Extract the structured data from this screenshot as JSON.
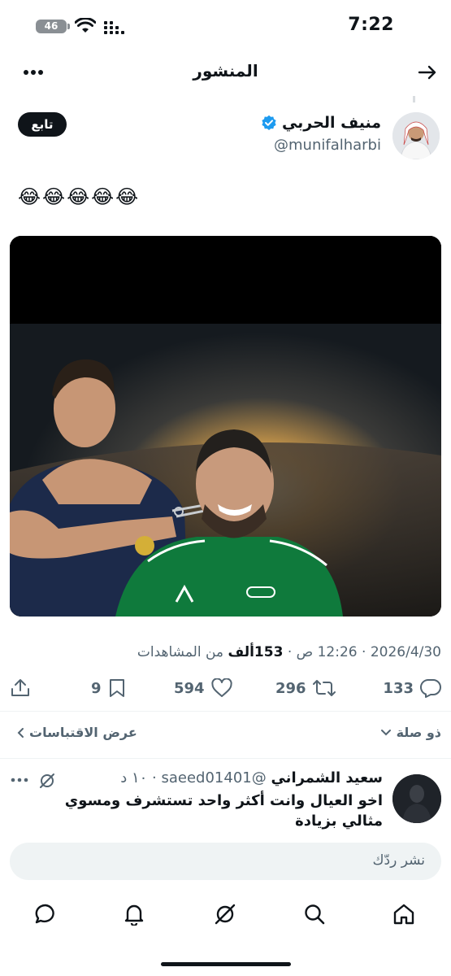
{
  "status_bar": {
    "time": "7:22",
    "battery": "46"
  },
  "header": {
    "title": "المنشور"
  },
  "author": {
    "name": "منيف الحربي",
    "handle": "@munifalharbi",
    "follow_label": "تابع"
  },
  "post": {
    "text": "😂😂😂😂😂",
    "date": "2026/4/30",
    "time": "12:26 ص",
    "views_count": "153ألف",
    "views_label": "من المشاهدات",
    "separator": "·"
  },
  "actions": {
    "replies": "133",
    "reposts": "296",
    "likes": "594",
    "bookmarks": "9"
  },
  "links": {
    "view_quotes": "عرض الاقتباسات",
    "relevance": "ذو صلة"
  },
  "reply_item": {
    "name": "سعيد الشمراني",
    "handle": "@saeed01401",
    "time": "١٠ د",
    "text": "اخو العيال وانت أكثر واحد تستشرف ومسوي مثالي بزيادة"
  },
  "composer": {
    "placeholder": "نشر ردّك"
  },
  "icons": [
    "back-arrow-icon",
    "more-icon",
    "verified-icon",
    "reply-icon",
    "repost-icon",
    "like-icon",
    "bookmark-icon",
    "share-icon",
    "home-icon",
    "search-icon",
    "grok-icon",
    "notifications-icon",
    "messages-icon"
  ],
  "colors": {
    "verified": "#1d9bf0",
    "text": "#0f1419",
    "muted": "#536471",
    "kit_green": "#0f7a3c",
    "kit_navy": "#1c2a4a"
  }
}
